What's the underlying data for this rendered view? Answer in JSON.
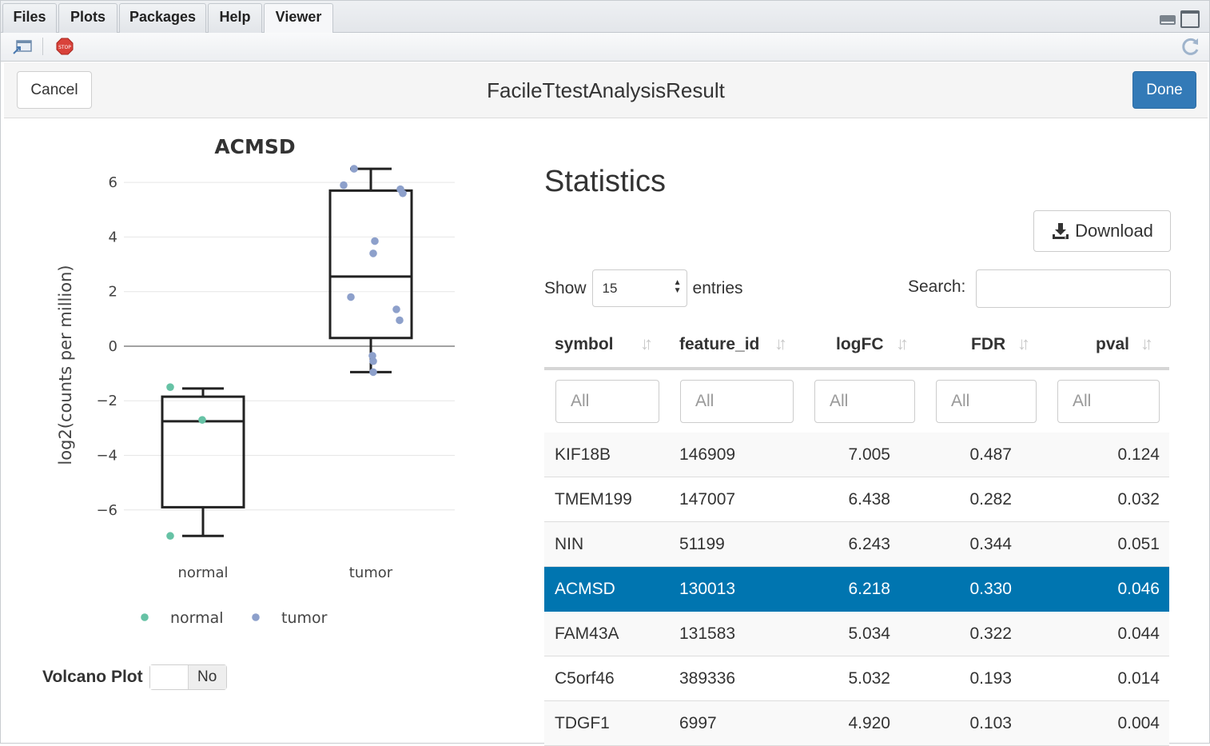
{
  "tabs": [
    {
      "label": "Files"
    },
    {
      "label": "Plots"
    },
    {
      "label": "Packages"
    },
    {
      "label": "Help"
    },
    {
      "label": "Viewer",
      "active": true
    }
  ],
  "gadget": {
    "cancel_label": "Cancel",
    "title": "FacileTtestAnalysisResult",
    "done_label": "Done"
  },
  "colors": {
    "done": "#337ab7",
    "selected_row": "#0075b0",
    "normal": "#66c2a5",
    "tumor": "#8da0cb"
  },
  "chart_data": {
    "type": "box",
    "title": "ACMSD",
    "xlabel": "",
    "ylabel": "log2(counts per million)",
    "categories": [
      "normal",
      "tumor"
    ],
    "ylim": [
      -7.5,
      7
    ],
    "yticks": [
      6,
      4,
      2,
      0,
      -2,
      -4,
      -6
    ],
    "ytick_labels": [
      "6",
      "4",
      "2",
      "0",
      "−2",
      "−4",
      "−6"
    ],
    "grid": true,
    "legend_position": "bottom",
    "boxes": [
      {
        "name": "normal",
        "whisker_low": -6.95,
        "q1": -5.9,
        "median": -2.75,
        "q3": -1.85,
        "whisker_high": -1.55
      },
      {
        "name": "tumor",
        "whisker_low": -0.95,
        "q1": 0.3,
        "median": 2.55,
        "q3": 5.7,
        "whisker_high": 6.5
      }
    ],
    "series": [
      {
        "name": "normal",
        "color": "#66c2a5",
        "points": [
          {
            "x": "normal",
            "y": -1.5
          },
          {
            "x": "normal",
            "y": -2.7
          },
          {
            "x": "normal",
            "y": -6.95
          }
        ]
      },
      {
        "name": "tumor",
        "color": "#8da0cb",
        "points": [
          {
            "x": "tumor",
            "y": 6.5
          },
          {
            "x": "tumor",
            "y": 5.9
          },
          {
            "x": "tumor",
            "y": 5.75
          },
          {
            "x": "tumor",
            "y": 5.6
          },
          {
            "x": "tumor",
            "y": 3.85
          },
          {
            "x": "tumor",
            "y": 3.4
          },
          {
            "x": "tumor",
            "y": 1.8
          },
          {
            "x": "tumor",
            "y": 1.35
          },
          {
            "x": "tumor",
            "y": 0.95
          },
          {
            "x": "tumor",
            "y": -0.35
          },
          {
            "x": "tumor",
            "y": -0.55
          },
          {
            "x": "tumor",
            "y": -0.95
          }
        ]
      }
    ]
  },
  "volcano": {
    "label": "Volcano Plot",
    "state": "No"
  },
  "stats": {
    "title": "Statistics",
    "download_label": "Download",
    "show_label": "Show",
    "entries_value": "15",
    "entries_label": "entries",
    "search_label": "Search:",
    "columns": [
      "symbol",
      "feature_id",
      "logFC",
      "FDR",
      "pval"
    ],
    "filter_placeholder": "All",
    "rows": [
      {
        "symbol": "KIF18B",
        "feature_id": "146909",
        "logFC": "7.005",
        "FDR": "0.487",
        "pval": "0.124"
      },
      {
        "symbol": "TMEM199",
        "feature_id": "147007",
        "logFC": "6.438",
        "FDR": "0.282",
        "pval": "0.032"
      },
      {
        "symbol": "NIN",
        "feature_id": "51199",
        "logFC": "6.243",
        "FDR": "0.344",
        "pval": "0.051"
      },
      {
        "symbol": "ACMSD",
        "feature_id": "130013",
        "logFC": "6.218",
        "FDR": "0.330",
        "pval": "0.046",
        "selected": true
      },
      {
        "symbol": "FAM43A",
        "feature_id": "131583",
        "logFC": "5.034",
        "FDR": "0.322",
        "pval": "0.044"
      },
      {
        "symbol": "C5orf46",
        "feature_id": "389336",
        "logFC": "5.032",
        "FDR": "0.193",
        "pval": "0.014"
      },
      {
        "symbol": "TDGF1",
        "feature_id": "6997",
        "logFC": "4.920",
        "FDR": "0.103",
        "pval": "0.004"
      }
    ]
  }
}
